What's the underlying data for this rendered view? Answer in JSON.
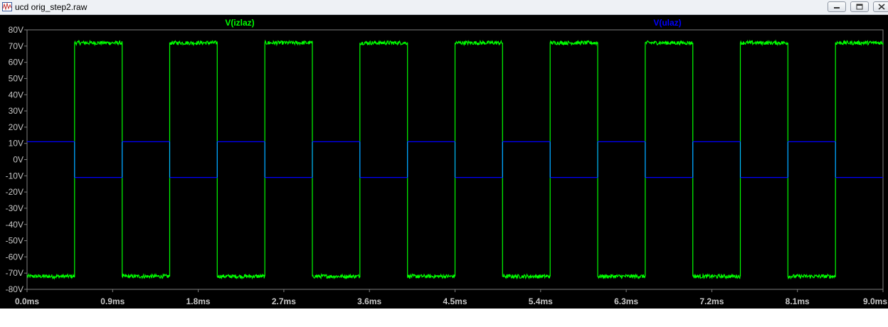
{
  "window": {
    "title": "ucd orig_step2.raw",
    "minimize_icon": "minimize-icon",
    "restore_icon": "restore-icon",
    "close_icon": "close-icon"
  },
  "colors": {
    "plot_background": "#000000",
    "axis_text": "#c8c8c8",
    "grid": "#808080",
    "trace_izlaz": "#00ff00",
    "trace_ulaz": "#0000ff",
    "edge_ulaz": "#00c0ff"
  },
  "chart_data": {
    "type": "line",
    "x_unit": "ms",
    "y_unit": "V",
    "xlim": [
      0,
      9.0
    ],
    "ylim": [
      -80,
      80
    ],
    "x_ticks": [
      "0.0ms",
      "0.9ms",
      "1.8ms",
      "2.7ms",
      "3.6ms",
      "4.5ms",
      "5.4ms",
      "6.3ms",
      "7.2ms",
      "8.1ms",
      "9.0ms"
    ],
    "y_ticks": [
      "80V",
      "70V",
      "60V",
      "50V",
      "40V",
      "30V",
      "20V",
      "10V",
      "0V",
      "-10V",
      "-20V",
      "-30V",
      "-40V",
      "-50V",
      "-60V",
      "-70V",
      "-80V"
    ],
    "grid": false,
    "legend_position": "top",
    "series": [
      {
        "name": "V(izlaz)",
        "color": "#00ff00",
        "noise_amplitude": 1.2,
        "x": [
          0,
          0.5,
          0.5,
          1.0,
          1.0,
          1.5,
          1.5,
          2.0,
          2.0,
          2.5,
          2.5,
          3.0,
          3.0,
          3.5,
          3.5,
          4.0,
          4.0,
          4.5,
          4.5,
          5.0,
          5.0,
          5.5,
          5.5,
          6.0,
          6.0,
          6.5,
          6.5,
          7.0,
          7.0,
          7.5,
          7.5,
          8.0,
          8.0,
          8.5,
          8.5,
          9.0
        ],
        "y": [
          -72,
          -72,
          72,
          72,
          -72,
          -72,
          72,
          72,
          -72,
          -72,
          72,
          72,
          -72,
          -72,
          72,
          72,
          -72,
          -72,
          72,
          72,
          -72,
          -72,
          72,
          72,
          -72,
          -72,
          72,
          72,
          -72,
          -72,
          72,
          72,
          -72,
          -72,
          72,
          72
        ]
      },
      {
        "name": "V(ulaz)",
        "color": "#0000ff",
        "x": [
          0,
          0.5,
          0.5,
          1.0,
          1.0,
          1.5,
          1.5,
          2.0,
          2.0,
          2.5,
          2.5,
          3.0,
          3.0,
          3.5,
          3.5,
          4.0,
          4.0,
          4.5,
          4.5,
          5.0,
          5.0,
          5.5,
          5.5,
          6.0,
          6.0,
          6.5,
          6.5,
          7.0,
          7.0,
          7.5,
          7.5,
          8.0,
          8.0,
          8.5,
          8.5,
          9.0
        ],
        "y": [
          11,
          11,
          -11,
          -11,
          11,
          11,
          -11,
          -11,
          11,
          11,
          -11,
          -11,
          11,
          11,
          -11,
          -11,
          11,
          11,
          -11,
          -11,
          11,
          11,
          -11,
          -11,
          11,
          11,
          -11,
          -11,
          11,
          11,
          -11,
          -11,
          11,
          11,
          -11,
          -11
        ]
      }
    ]
  }
}
